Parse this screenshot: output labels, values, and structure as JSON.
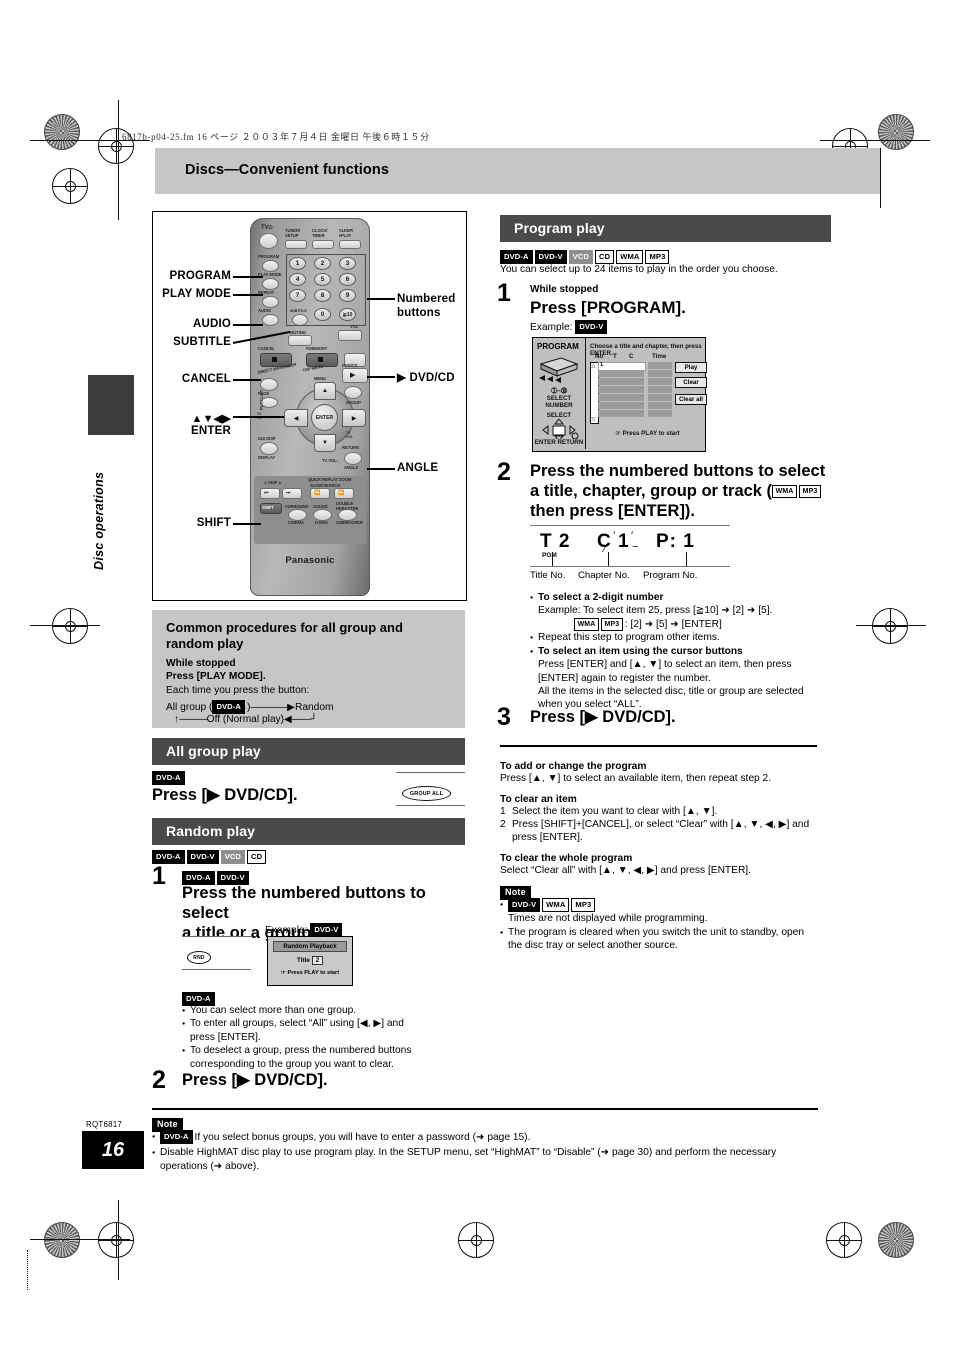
{
  "page": {
    "filename_line": "6817b-p04-25.fm   16 ページ   ２００３年７月４日   金曜日   午後６時１５分",
    "header_title": "Discs—Convenient functions",
    "side_tab_label": "Disc operations",
    "page_number": "16",
    "doc_code": "RQT6817"
  },
  "remote": {
    "brand": "Panasonic",
    "labels_left": [
      "PROGRAM",
      "PLAY MODE",
      "AUDIO",
      "SUBTITLE",
      "CANCEL",
      "▲▼◀▶",
      "ENTER",
      "SHIFT"
    ],
    "labels_right": [
      "Numbered",
      "buttons",
      "▶ DVD/CD",
      "ANGLE"
    ],
    "keys": {
      "tv": "TV",
      "tuner_setup": "TUNER/SETUP",
      "clock_timer": "CLOCK/TIMER",
      "sleep_play": "SLEEP/PLAY",
      "program": "PROGRAM",
      "play_mode": "PLAY MODE",
      "repeat": "REPEAT",
      "audio": "AUDIO",
      "subtitle": "SUBTITLE",
      "muting": "MUTING",
      "cancel": "CANCEL",
      "p_memory": "P.MEMORY",
      "direct_navigator": "DIRECT NAVIGATOR",
      "top_menu": "TOP MENU",
      "page": "PAGE",
      "menu": "MENU",
      "enter": "ENTER",
      "play_list": "PLAY LIST",
      "group": "GROUP",
      "gui_disp": "GUI DISP",
      "display": "DISPLAY",
      "tv_vol": "TV VOL",
      "tv_ch": "TV CH",
      "return": "RETURN",
      "angle": "ANGLE",
      "skip": "SKIP",
      "slow_search": "SLOW/SEARCH",
      "quick_replay": "QUICK REPLAY",
      "zoom": "ZOOM",
      "shift": "SHIFT",
      "surround": "SURROUND",
      "cinema": "CINEMA",
      "sound": "SOUND",
      "d_enh": "D.ENH",
      "double_rebaster": "DOUBLE REBASTER",
      "subwoofer": "SUBWOOFER",
      "dvd_cd": "DVD/CD",
      "numbers": [
        "1",
        "2",
        "3",
        "4",
        "5",
        "6",
        "7",
        "8",
        "9",
        "0",
        "≧10"
      ]
    }
  },
  "common_procedures": {
    "title": "Common procedures for all group and random play",
    "while_stopped": "While stopped",
    "press_line": "Press [PLAY MODE].",
    "each_time": "Each time you press the button:",
    "cycle_left": "All group (",
    "cycle_chip": "DVD-A",
    "cycle_left_end": ")",
    "cycle_right": "Random",
    "cycle_bottom": "Off (Normal play)"
  },
  "all_group_play": {
    "heading": "All group play",
    "chips": [
      "DVD-A"
    ],
    "press": "Press [▶ DVD/CD].",
    "display_indicator": "GROUP ALL"
  },
  "random_play": {
    "heading": "Random play",
    "chips": [
      "DVD-A",
      "DVD-V",
      "VCD",
      "CD"
    ],
    "step1": {
      "num": "1",
      "chips": [
        "DVD-A",
        "DVD-V"
      ],
      "title_line1": "Press the numbered buttons to select",
      "title_line2": "a title or a group.",
      "example_label": "Example:",
      "example_chip": "DVD-V",
      "fl_indicator": "RND",
      "osd": {
        "title": "Random Playback",
        "field_label": "Title",
        "field_value": "2",
        "footer": "☞ Press PLAY to start"
      },
      "notes_chip": "DVD-A",
      "notes": [
        "You can select more than one group.",
        "To enter all groups, select “All” using [◀, ▶] and press [ENTER].",
        "To deselect a group, press the numbered buttons corresponding to the group you want to clear."
      ]
    },
    "step2": {
      "num": "2",
      "title": "Press [▶ DVD/CD]."
    }
  },
  "program_play": {
    "heading": "Program play",
    "chips": [
      "DVD-A",
      "DVD-V",
      "VCD",
      "CD",
      "WMA",
      "MP3"
    ],
    "intro": "You can select up to 24 items to play in the order you choose.",
    "step1": {
      "num": "1",
      "while_stopped": "While stopped",
      "title": "Press [PROGRAM].",
      "example_label": "Example:",
      "example_chip": "DVD-V",
      "osd": {
        "title": "PROGRAM",
        "prompt": "Choose a title and chapter, then press ENTER.",
        "columns": [
          "No",
          "T",
          "C",
          "Time"
        ],
        "first_row_no": "1",
        "buttons": [
          "Play",
          "Clear",
          "Clear all"
        ],
        "side_keys": [
          "➀–➉",
          "SELECT",
          "NUMBER",
          "SELECT",
          "ENTER",
          "RETURN"
        ],
        "footer": "☞ Press PLAY to start"
      }
    },
    "step2": {
      "num": "2",
      "title_line1": "Press the numbered buttons to select",
      "title_line2a": "a title, chapter, group or track (",
      "title_line2_chips": [
        "WMA",
        "MP3"
      ],
      "title_line3": "then press [ENTER]).",
      "fl_display": {
        "title_no": "T 2",
        "pgm": "PGM",
        "chapter_no": "C 1",
        "program_no": "P:  1",
        "label_title": "Title No.",
        "label_chapter": "Chapter No.",
        "label_program": "Program No."
      },
      "notes": [
        {
          "bold": "To select a 2-digit number",
          "lines": [
            "Example:  To select item 25, press [≧10] ➜ [2] ➜ [5]."
          ],
          "chip_line": {
            "chips": [
              "WMA",
              "MP3"
            ],
            "text": ": [2] ➜ [5] ➜ [ENTER]"
          }
        },
        {
          "plain": "Repeat this step to program other items."
        },
        {
          "bold": "To select an item using the cursor buttons",
          "lines": [
            "Press [ENTER] and [▲, ▼] to select an item, then press [ENTER] again to register the number.",
            "All the items in the selected disc, title or group are selected when you select “ALL”."
          ]
        }
      ]
    },
    "step3": {
      "num": "3",
      "title": "Press [▶ DVD/CD]."
    },
    "extras": [
      {
        "head": "To add or change the program",
        "body": [
          "Press [▲, ▼] to select an available item, then repeat step 2."
        ]
      },
      {
        "head": "To clear an item",
        "numbered": [
          "Select the item you want to clear with [▲, ▼].",
          "Press [SHIFT]+[CANCEL], or select “Clear” with [▲, ▼, ◀, ▶] and press [ENTER]."
        ]
      },
      {
        "head": "To clear the whole program",
        "body": [
          "Select “Clear all” with [▲, ▼, ◀, ▶] and press [ENTER]."
        ]
      }
    ],
    "note": {
      "badge": "Note",
      "chips": [
        "DVD-V",
        "WMA",
        "MP3"
      ],
      "items": [
        "Times are not displayed while programming.",
        "The program is cleared when you switch the unit to standby, open the disc tray or select another source."
      ]
    }
  },
  "bottom_note": {
    "badge": "Note",
    "item1_chip": "DVD-A",
    "item1": "If you select bonus groups, you will have to enter a password (➜ page 15).",
    "item2": "Disable HighMAT disc play to use program play. In the SETUP menu, set “HighMAT” to “Disable” (➜ page 30) and perform the necessary operations (➜ above)."
  }
}
